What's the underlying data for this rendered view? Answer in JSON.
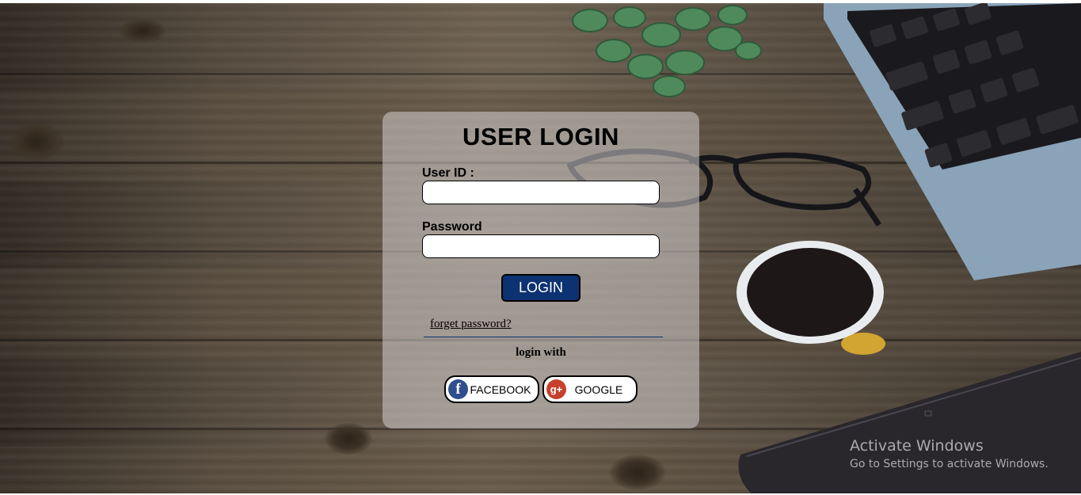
{
  "login": {
    "title": "USER LOGIN",
    "userid_label": "User ID :",
    "userid_value": "",
    "password_label": "Password",
    "password_value": "",
    "login_button": "LOGIN",
    "forget_link": "forget password?",
    "login_with": "login with",
    "facebook_button": "FACEBOOK",
    "google_button": "GOOGLE"
  },
  "icons": {
    "facebook": "facebook-icon",
    "google": "google-plus-icon",
    "facebook_glyph": "f",
    "google_glyph": "g+"
  },
  "watermark": {
    "line1": "Activate Windows",
    "line2": "Go to Settings to activate Windows."
  },
  "colors": {
    "login_button_bg": "#0d3272",
    "facebook_blue": "#2f4e8e",
    "google_red": "#c6402c"
  }
}
